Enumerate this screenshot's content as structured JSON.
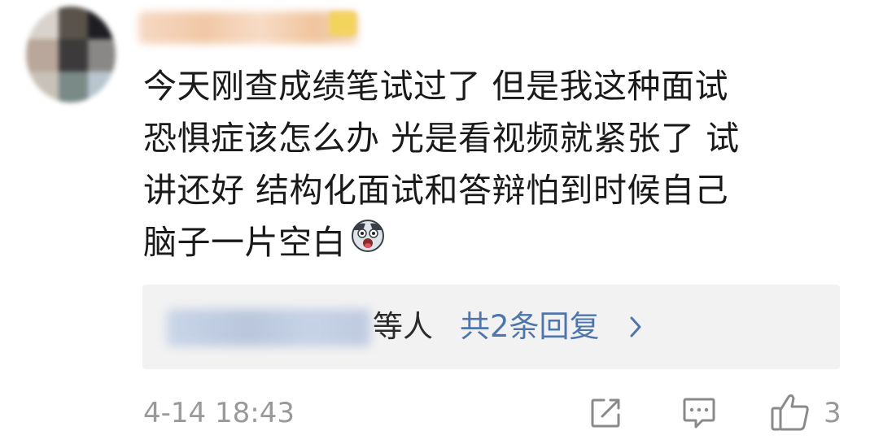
{
  "comment": {
    "lines": [
      "今天刚查成绩笔试过了 但是我这种面试",
      "恐惧症该怎么办 光是看视频就紧张了 试",
      "讲还好 结构化面试和答辩怕到时候自己",
      "脑子一片空白"
    ],
    "emoji": "scared-face-emoji"
  },
  "replies": {
    "suffix": "等人",
    "count_label": "共2条回复",
    "chevron": "chevron-right-icon"
  },
  "footer": {
    "timestamp": "4-14 18:43",
    "like_count": "3",
    "icons": [
      "share-edit-icon",
      "comment-icon",
      "thumbs-up-icon"
    ]
  },
  "colors": {
    "text": "#1a1a1a",
    "link": "#4f76ac",
    "meta": "#999999",
    "reply_bg": "#f2f2f2"
  }
}
